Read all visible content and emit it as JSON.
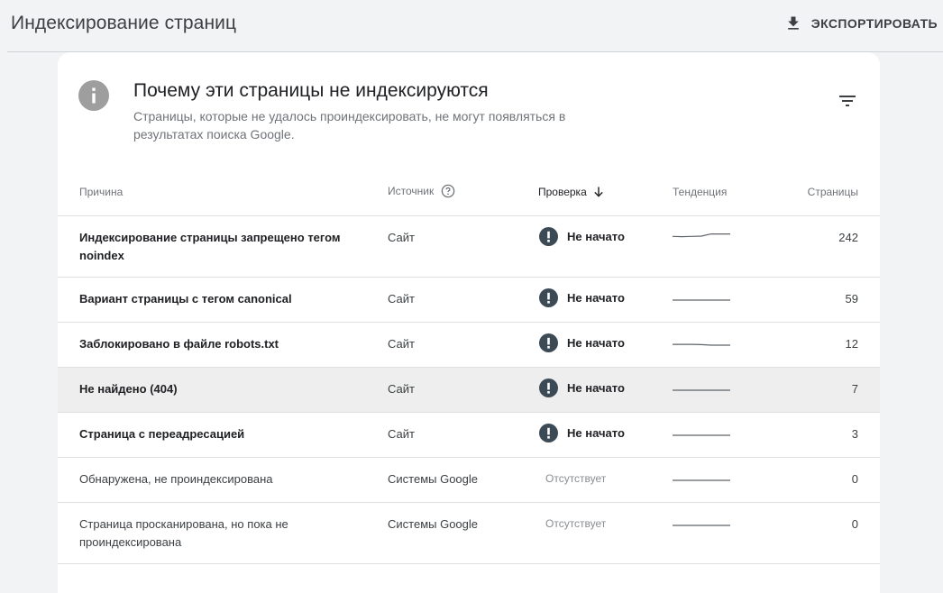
{
  "header": {
    "title": "Индексирование страниц",
    "export_label": "ЭКСПОРТИРОВАТЬ"
  },
  "card": {
    "title": "Почему эти страницы не индексируются",
    "description": "Страницы, которые не удалось проиндексировать, не могут появляться в результатах поиска Google."
  },
  "table": {
    "columns": {
      "reason": "Причина",
      "source": "Источник",
      "check": "Проверка",
      "trend": "Тенденция",
      "pages": "Страницы"
    },
    "rows": [
      {
        "reason": "Индексирование страницы запрещено тегом noindex",
        "source": "Сайт",
        "check": "Не начато",
        "status": "not-started",
        "trend": [
          0.45,
          0.4,
          0.45,
          0.5,
          0.9,
          0.9,
          0.9
        ],
        "pages": "242",
        "bold": true,
        "two_line": true
      },
      {
        "reason": "Вариант страницы с тегом canonical",
        "source": "Сайт",
        "check": "Не начато",
        "status": "not-started",
        "trend": [
          0,
          0,
          0,
          0,
          0,
          0,
          0
        ],
        "pages": "59",
        "bold": true
      },
      {
        "reason": "Заблокировано в файле robots.txt",
        "source": "Сайт",
        "check": "Не начато",
        "status": "not-started",
        "trend": [
          0.15,
          0.15,
          0.15,
          0.1,
          0,
          0,
          0
        ],
        "pages": "12",
        "bold": true
      },
      {
        "reason": "Не найдено (404)",
        "source": "Сайт",
        "check": "Не начато",
        "status": "not-started",
        "trend": [
          0,
          0,
          0,
          0,
          0,
          0,
          0
        ],
        "pages": "7",
        "bold": true,
        "highlighted": true
      },
      {
        "reason": "Страница с переадресацией",
        "source": "Сайт",
        "check": "Не начато",
        "status": "not-started",
        "trend": [
          0,
          0,
          0,
          0,
          0,
          0,
          0
        ],
        "pages": "3",
        "bold": true
      },
      {
        "reason": "Обнаружена, не проиндексирована",
        "source": "Системы Google",
        "check": "Отсутствует",
        "status": "absent",
        "trend": [
          0,
          0,
          0,
          0,
          0,
          0,
          0
        ],
        "pages": "0",
        "bold": false
      },
      {
        "reason": "Страница просканирована, но пока не проиндексирована",
        "source": "Системы Google",
        "check": "Отсутствует",
        "status": "absent",
        "trend": [
          0,
          0,
          0,
          0,
          0,
          0,
          0
        ],
        "pages": "0",
        "bold": false,
        "two_line": true
      }
    ]
  },
  "icons": {
    "export": "download-icon",
    "info": "info-icon",
    "filter": "filter-icon",
    "help": "help-circle-icon",
    "sort": "arrow-down-icon",
    "status": "exclamation-circle-icon"
  },
  "colors": {
    "status_icon": "#3c4a56",
    "info_icon_bg": "#9e9e9e",
    "trend_line": "#5f6368"
  }
}
